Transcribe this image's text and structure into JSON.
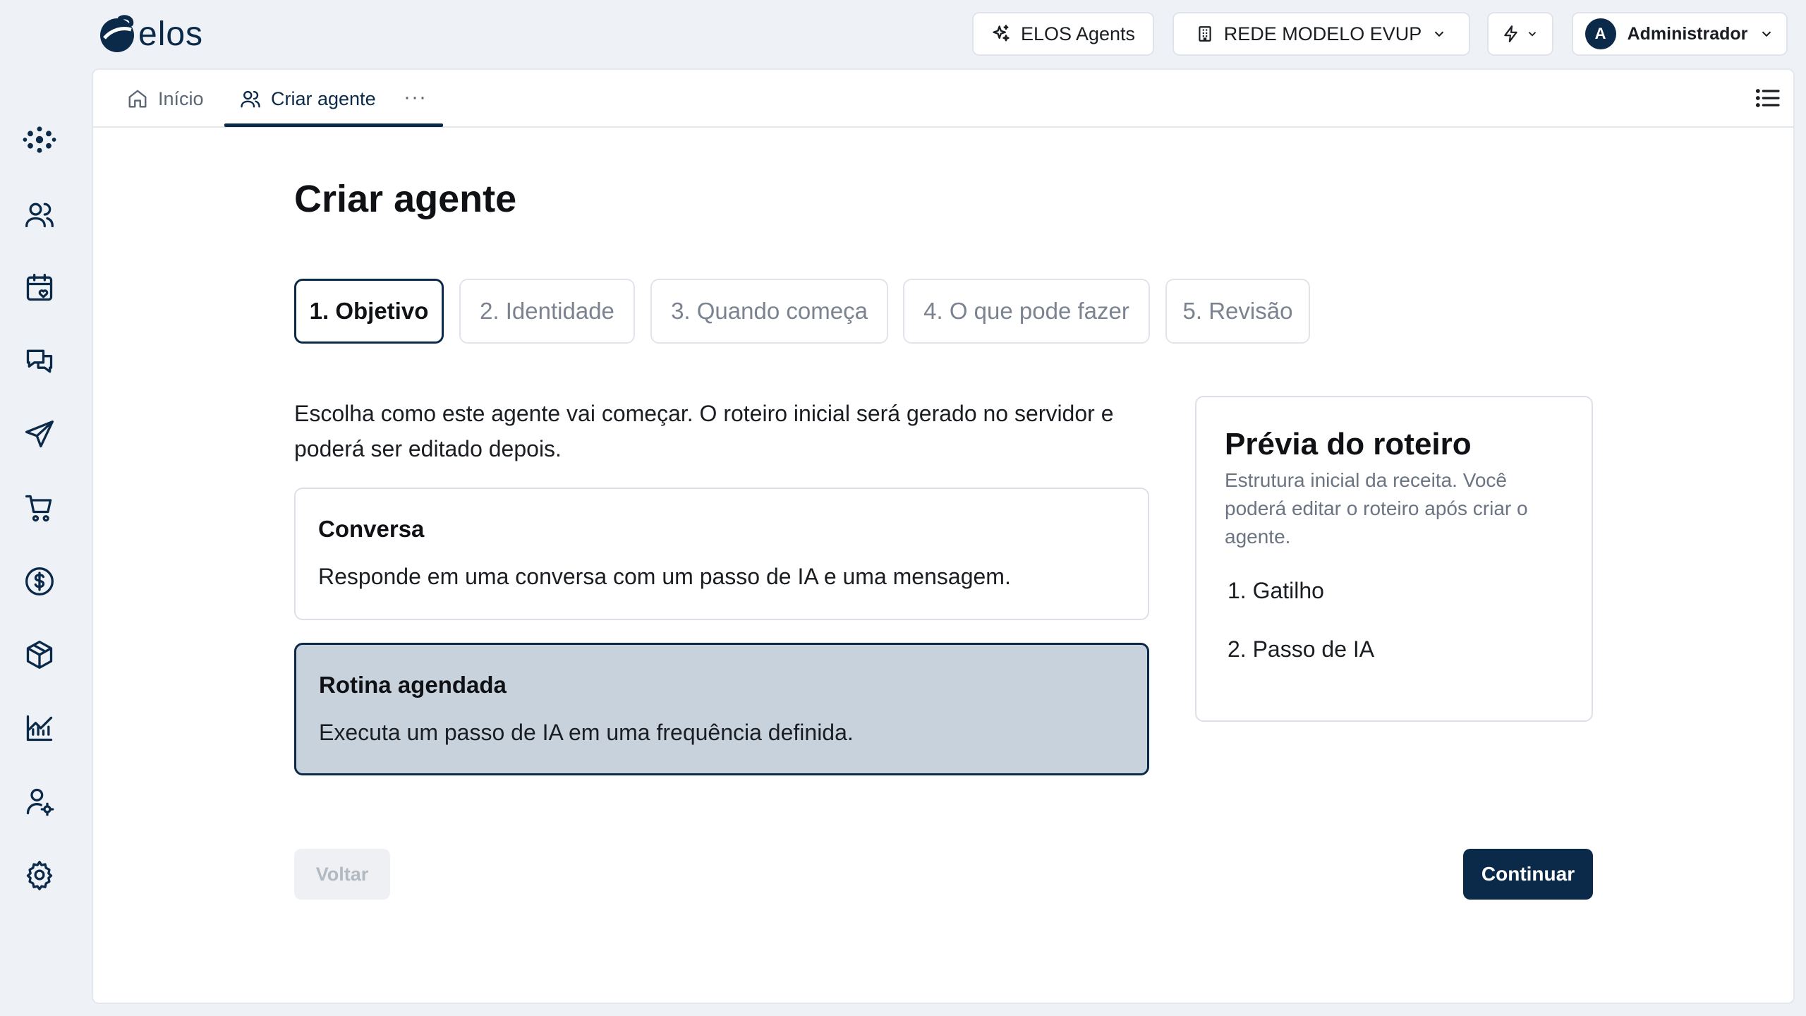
{
  "app": {
    "logo_text": "elos"
  },
  "topbar": {
    "agents_label": "ELOS Agents",
    "org_label": "REDE MODELO EVUP",
    "user_initial": "A",
    "user_name": "Administrador"
  },
  "sidebar": {
    "icons": [
      "dashboard-icon",
      "users-icon",
      "calendar-heart-icon",
      "chat-icon",
      "send-icon",
      "cart-icon",
      "dollar-icon",
      "box-icon",
      "chart-icon",
      "user-settings-icon",
      "gear-icon"
    ]
  },
  "tabs": {
    "home_label": "Início",
    "active_label": "Criar agente",
    "more_label": "···"
  },
  "page": {
    "title": "Criar agente"
  },
  "steps": [
    {
      "label": "1. Objetivo",
      "active": true
    },
    {
      "label": "2. Identidade",
      "active": false
    },
    {
      "label": "3. Quando começa",
      "active": false
    },
    {
      "label": "4. O que pode fazer",
      "active": false
    },
    {
      "label": "5. Revisão",
      "active": false
    }
  ],
  "intro": "Escolha como este agente vai começar. O roteiro inicial será gerado no servidor e poderá ser editado depois.",
  "options": [
    {
      "title": "Conversa",
      "description": "Responde em uma conversa com um passo de IA e uma mensagem.",
      "selected": false
    },
    {
      "title": "Rotina agendada",
      "description": "Executa um passo de IA em uma frequência definida.",
      "selected": true
    }
  ],
  "preview": {
    "title": "Prévia do roteiro",
    "subtitle": "Estrutura inicial da receita. Você poderá editar o roteiro após criar o agente.",
    "items": [
      "1. Gatilho",
      "2. Passo de IA"
    ]
  },
  "actions": {
    "back_label": "Voltar",
    "next_label": "Continuar"
  },
  "colors": {
    "brand": "#0b2a4a",
    "selected_bg": "#c8d2dc",
    "app_bg": "#eef1f5"
  }
}
